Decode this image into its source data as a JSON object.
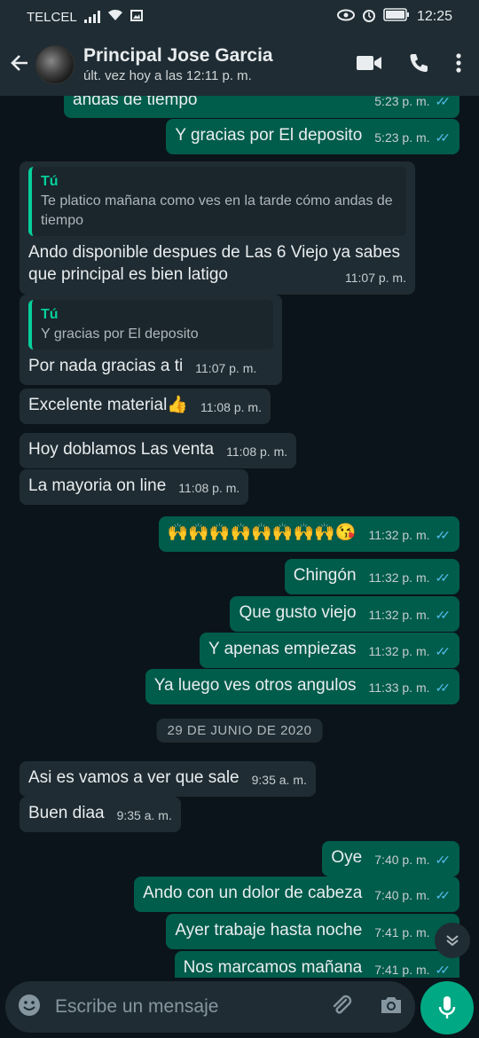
{
  "statusbar": {
    "carrier": "TELCEL",
    "time": "12:25"
  },
  "header": {
    "name": "Principal Jose Garcia",
    "status": "últ. vez hoy a las 12:11 p. m."
  },
  "messages": [
    {
      "text": "andas de tiempo",
      "time": "5:23 p. m."
    },
    {
      "text": "Y gracias por El deposito",
      "time": "5:23 p. m."
    },
    {
      "quote_name": "Tú",
      "quote_text": "Te platico mañana como ves en la tarde cómo andas de tiempo",
      "text": "Ando disponible despues de Las 6 Viejo ya sabes que principal es bien latigo",
      "time": "11:07 p. m."
    },
    {
      "quote_name": "Tú",
      "quote_text": "Y gracias por El deposito",
      "text": "Por nada gracias a ti",
      "time": "11:07 p. m."
    },
    {
      "text": "Excelente material👍",
      "time": "11:08 p. m."
    },
    {
      "text": "Hoy doblamos Las venta",
      "time": "11:08 p. m."
    },
    {
      "text": "La mayoria on line",
      "time": "11:08 p. m."
    },
    {
      "text": "🙌🙌🙌🙌🙌🙌🙌🙌😘",
      "time": "11:32 p. m."
    },
    {
      "text": "Chingón",
      "time": "11:32 p. m."
    },
    {
      "text": "Que gusto viejo",
      "time": "11:32 p. m."
    },
    {
      "text": "Y apenas empiezas",
      "time": "11:32 p. m."
    },
    {
      "text": "Ya luego ves otros angulos",
      "time": "11:33 p. m."
    },
    {
      "text": "Asi es vamos a ver que sale",
      "time": "9:35 a. m."
    },
    {
      "text": "Buen diaa",
      "time": "9:35 a. m."
    },
    {
      "text": "Oye",
      "time": "7:40 p. m."
    },
    {
      "text": "Ando con un dolor de cabeza",
      "time": "7:40 p. m."
    },
    {
      "text": "Ayer trabaje hasta noche",
      "time": "7:41 p. m."
    },
    {
      "text": "Nos marcamos mañana",
      "time": "7:41 p. m."
    }
  ],
  "date_separator": "29 DE JUNIO DE 2020",
  "composer": {
    "placeholder": "Escribe un mensaje"
  },
  "icons": [
    "back-arrow-icon",
    "video-call-icon",
    "phone-icon",
    "more-options-icon",
    "emoji-icon",
    "attach-icon",
    "camera-icon",
    "mic-icon",
    "scroll-down-icon"
  ]
}
